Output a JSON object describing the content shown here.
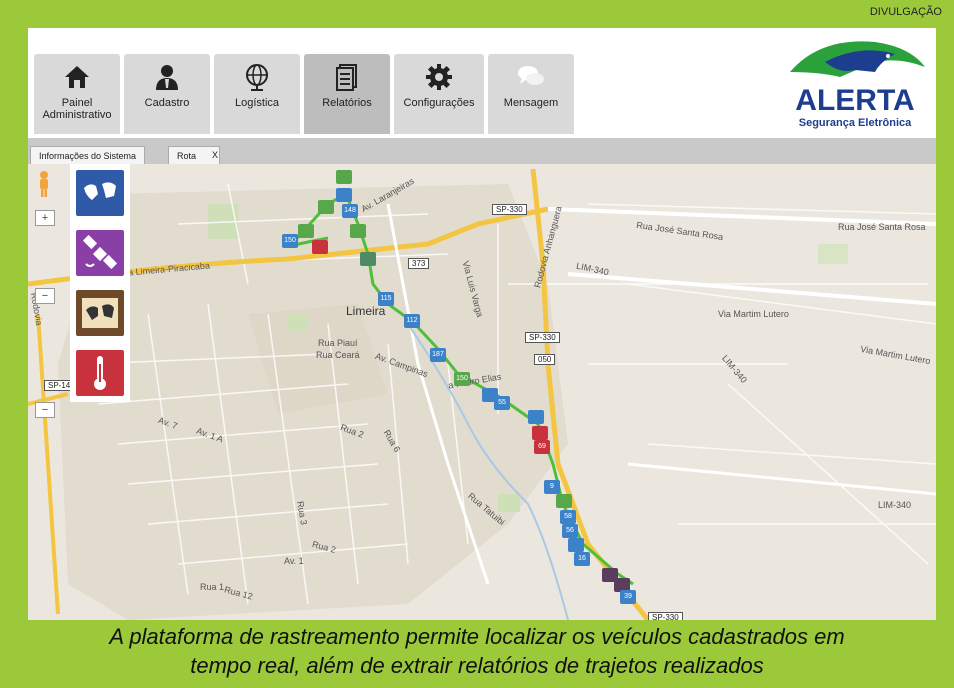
{
  "credit": "DIVULGAÇÃO",
  "nav_tabs": [
    {
      "label": "Painel Administrativo",
      "icon": "home-icon"
    },
    {
      "label": "Cadastro",
      "icon": "user-icon"
    },
    {
      "label": "Logística",
      "icon": "globe-icon"
    },
    {
      "label": "Relatórios",
      "icon": "document-icon",
      "active": true
    },
    {
      "label": "Configurações",
      "icon": "gear-icon"
    },
    {
      "label": "Mensagem",
      "icon": "chat-icon"
    }
  ],
  "logo": {
    "name": "ALERTA",
    "tagline": "Segurança Eletrônica"
  },
  "subtabs": {
    "info": "Informações do Sistema",
    "route": "Rota",
    "close": "X"
  },
  "map_tools": [
    {
      "icon": "world-map-icon",
      "color": "#2f5aa8"
    },
    {
      "icon": "satellite-icon",
      "color": "#8a3fa6"
    },
    {
      "icon": "old-map-icon",
      "color": "#6e4a2a"
    },
    {
      "icon": "thermometer-icon",
      "color": "#c8323c"
    }
  ],
  "map_labels": {
    "city": "Limeira",
    "sp330a": "SP-330",
    "sp330b": "SP-330",
    "sp330c": "SP-330",
    "r373": "373",
    "r050": "050",
    "sp14": "SP-14",
    "rua_jsr1": "Rua José Santa Rosa",
    "rua_jsr2": "Rua José Santa Rosa",
    "lim340a": "LIM-340",
    "lim340b": "LIM-340",
    "lim340c": "LIM-340",
    "via_martim1": "Via Martim Lutero",
    "via_martim2": "Via Martim Lutero",
    "av_laranjeiras": "Av. Laranjeiras",
    "via_luis": "Via Luis Varga",
    "rodovia": "Rodovia Anhanguera",
    "limeira_pir": "a Limeira-Piracicaba",
    "rua_piaui": "Rua Piauí",
    "rua_ceara": "Rua Ceará",
    "av_campinas": "Av. Campinas",
    "pedro_elias": "a Pedro Elias",
    "rua2": "Rua 2",
    "rua6": "Rua 6",
    "rua3": "Rua 3",
    "rua2b": "Rua 2",
    "av1": "Av. 1",
    "rua1": "Rua 1",
    "rua12": "Rua 12",
    "rua_tatuibi": "Rua Tatuibi",
    "av7": "Av. 7",
    "av1a": "Av. 1 A",
    "rodovia_left": "Rodovia"
  },
  "markers": [
    "150",
    "148",
    "187",
    "115",
    "112",
    "187",
    "150",
    "55",
    "69",
    "9",
    "58",
    "56",
    "16",
    "39"
  ],
  "caption_line1": "A plataforma de rastreamento permite localizar os veículos cadastrados em",
  "caption_line2": "tempo real, além de extrair relatórios de trajetos realizados"
}
